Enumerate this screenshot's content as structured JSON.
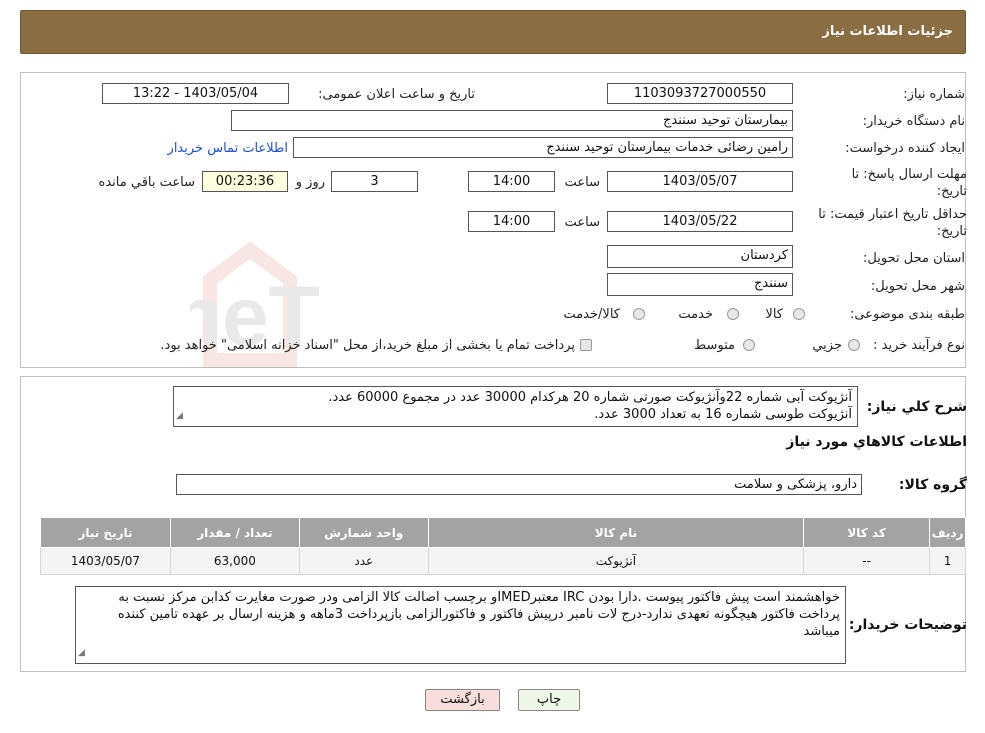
{
  "header": {
    "title": "جزئیات اطلاعات نیاز"
  },
  "form": {
    "need_number_label": "شماره نیاز:",
    "need_number": "1103093727000550",
    "announce_label": "تاریخ و ساعت اعلان عمومی:",
    "announce_value": "1403/05/04 - 13:22",
    "buyer_org_label": "نام دستگاه خریدار:",
    "buyer_org": "بیمارستان توحید سنندج",
    "requester_label": "ایجاد کننده درخواست:",
    "requester": "رامین رضائی خدمات بیمارستان توحید سنندج",
    "contact_link": "اطلاعات تماس خریدار",
    "deadline_label_1": "مهلت ارسال پاسخ: تا",
    "deadline_label_2": "تاریخ:",
    "deadline_date": "1403/05/07",
    "time_label": "ساعت",
    "deadline_time": "14:00",
    "days_value": "3",
    "days_label": "روز و",
    "remaining_value": "00:23:36",
    "remaining_label": "ساعت باقي مانده",
    "validity_label_1": "حداقل تاریخ اعتبار قیمت: تا",
    "validity_label_2": "تاریخ:",
    "validity_date": "1403/05/22",
    "validity_time_label": "ساعت",
    "validity_time": "14:00",
    "province_label": "استان محل تحویل:",
    "province": "کردستان",
    "city_label": "شهر محل تحویل:",
    "city": "سنندج",
    "category_label": "طبقه بندی موضوعی:",
    "category_options": [
      "کالا",
      "خدمت",
      "کالا/خدمت"
    ],
    "process_label": "نوع فرآیند خرید :",
    "process_options": [
      "جزیي",
      "متوسط"
    ],
    "process_note": "پرداخت تمام یا بخشی از مبلغ خرید،از محل \"اسناد خزانه اسلامی\" خواهد بود."
  },
  "description": {
    "label": "شرح کلي نیاز:",
    "line1": "آنژیوکت آبی شماره 22وآنژیوکت صورتی شماره 20  هرکدام 30000 عدد در مجموع   60000 عدد.",
    "line2": "آنژیوکت طوسی شماره 16 به تعداد   3000 عدد."
  },
  "goods": {
    "title": "اطلاعات کالاهاي مورد نیاز",
    "group_label": "گروه کالا:",
    "group_value": "دارو، پزشکی و سلامت",
    "columns": [
      "ردیف",
      "کد کالا",
      "نام کالا",
      "واحد شمارش",
      "تعداد / مقدار",
      "تاریخ نیاز"
    ],
    "rows": [
      {
        "row": "1",
        "code": "--",
        "name": "آنژیوکت",
        "unit": "عدد",
        "qty": "63,000",
        "date": "1403/05/07"
      }
    ]
  },
  "buyer_notes": {
    "label": "توضیحات خریدار:",
    "text": "خواهشمند است پیش فاکتور پیوست .دارا بودن IRC معتبرIMEDو برچسب اصالت کالا الزامی ودر صورت مغایرت کدابن مرکز نسبت به پرداخت فاکتور هیچگونه تعهدی ندارد-درج لات نامبر درپیش فاکتور و فاکتورالزامی  بازپرداخت 3ماهه و هزینه ارسال بر عهده تامین کننده میباشد"
  },
  "buttons": {
    "print": "چاپ",
    "back": "بازگشت"
  },
  "watermark": {
    "text": "AriaTender.neT"
  },
  "colors": {
    "header_bg": "#8b6d43",
    "table_header": "#a3a3a3",
    "link": "#1a4fd6",
    "back_btn": "#f9dede"
  }
}
